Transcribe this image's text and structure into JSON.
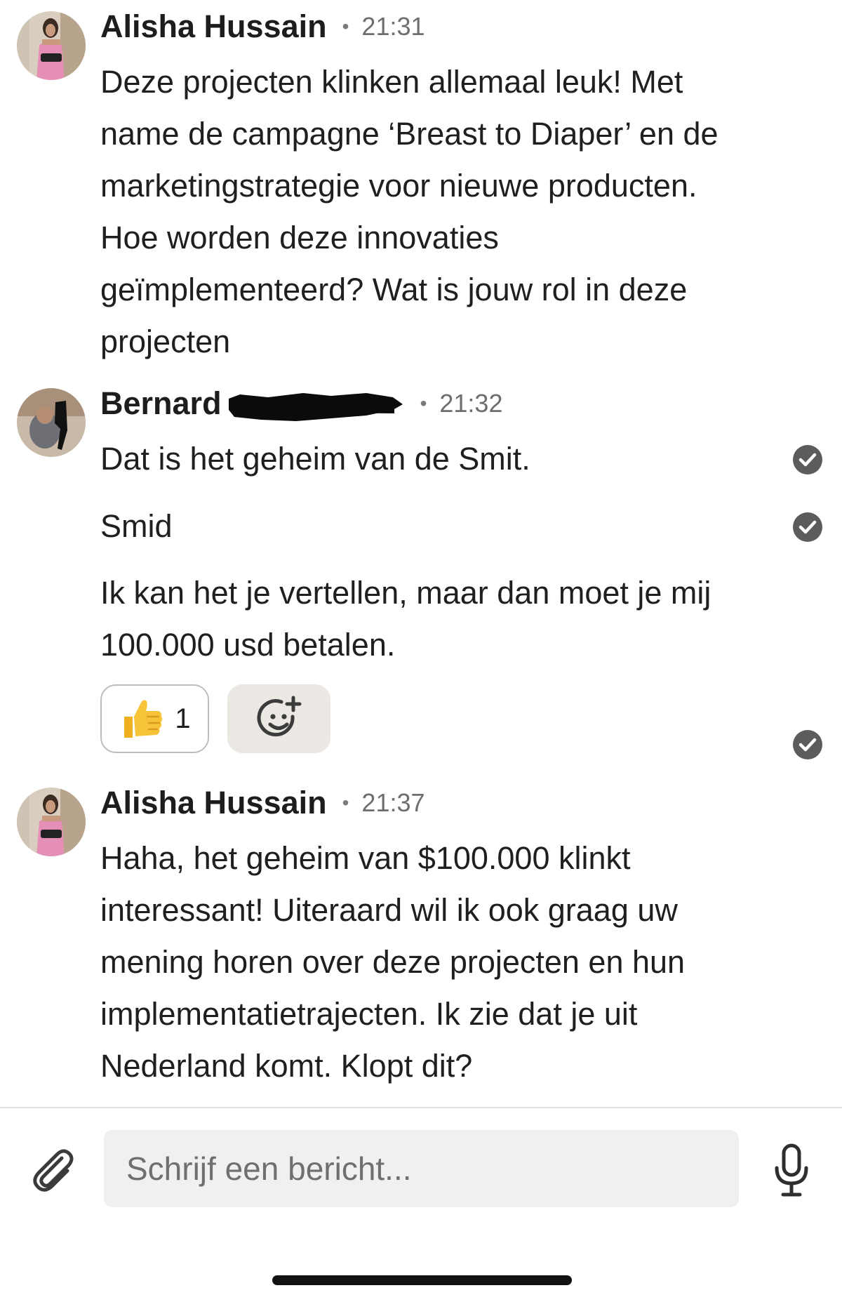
{
  "messages": [
    {
      "sender": "Alisha Hussain",
      "separator": "•",
      "time": "21:31",
      "avatar": "avatar-photo",
      "paragraphs": [
        "Deze projecten klinken allemaal leuk! Met name de campagne ‘Breast to Diaper’ en de marketingstrategie voor nieuwe producten. Hoe worden deze innovaties geïmplementeerd? Wat is jouw rol in deze projecten"
      ]
    },
    {
      "sender": "Bernard",
      "separator": "•",
      "time": "21:32",
      "avatar": "avatar-photo",
      "surname_redacted": true,
      "paragraphs": [
        "Dat is het geheim van de Smit.",
        "Smid",
        "Ik kan het je vertellen, maar dan moet je mij 100.000 usd betalen."
      ],
      "reactions": [
        {
          "emoji": "👍",
          "count": "1"
        }
      ],
      "add_reaction_icon": "add-reaction-icon",
      "status_icon": "read-check-icon"
    },
    {
      "sender": "Alisha Hussain",
      "separator": "•",
      "time": "21:37",
      "avatar": "avatar-photo",
      "paragraphs": [
        "Haha, het geheim van $100.000 klinkt interessant! Uiteraard wil ik ook graag uw mening horen over deze projecten en hun implementatietrajecten. Ik zie dat je uit Nederland komt. Klopt dit?"
      ]
    }
  ],
  "composer": {
    "placeholder": "Schrijf een bericht...",
    "value": "",
    "attach_icon": "paperclip-icon",
    "voice_icon": "microphone-icon"
  },
  "colors": {
    "text": "#1f1f1f",
    "timestamp": "#6e6e6e",
    "check": "#5c5c5c",
    "reaction_border": "#bdbdbd",
    "reaction_add_bg": "#ebe8e3",
    "composer_bg": "#f1f0ee",
    "thumbs_yellow": "#f7c439"
  }
}
